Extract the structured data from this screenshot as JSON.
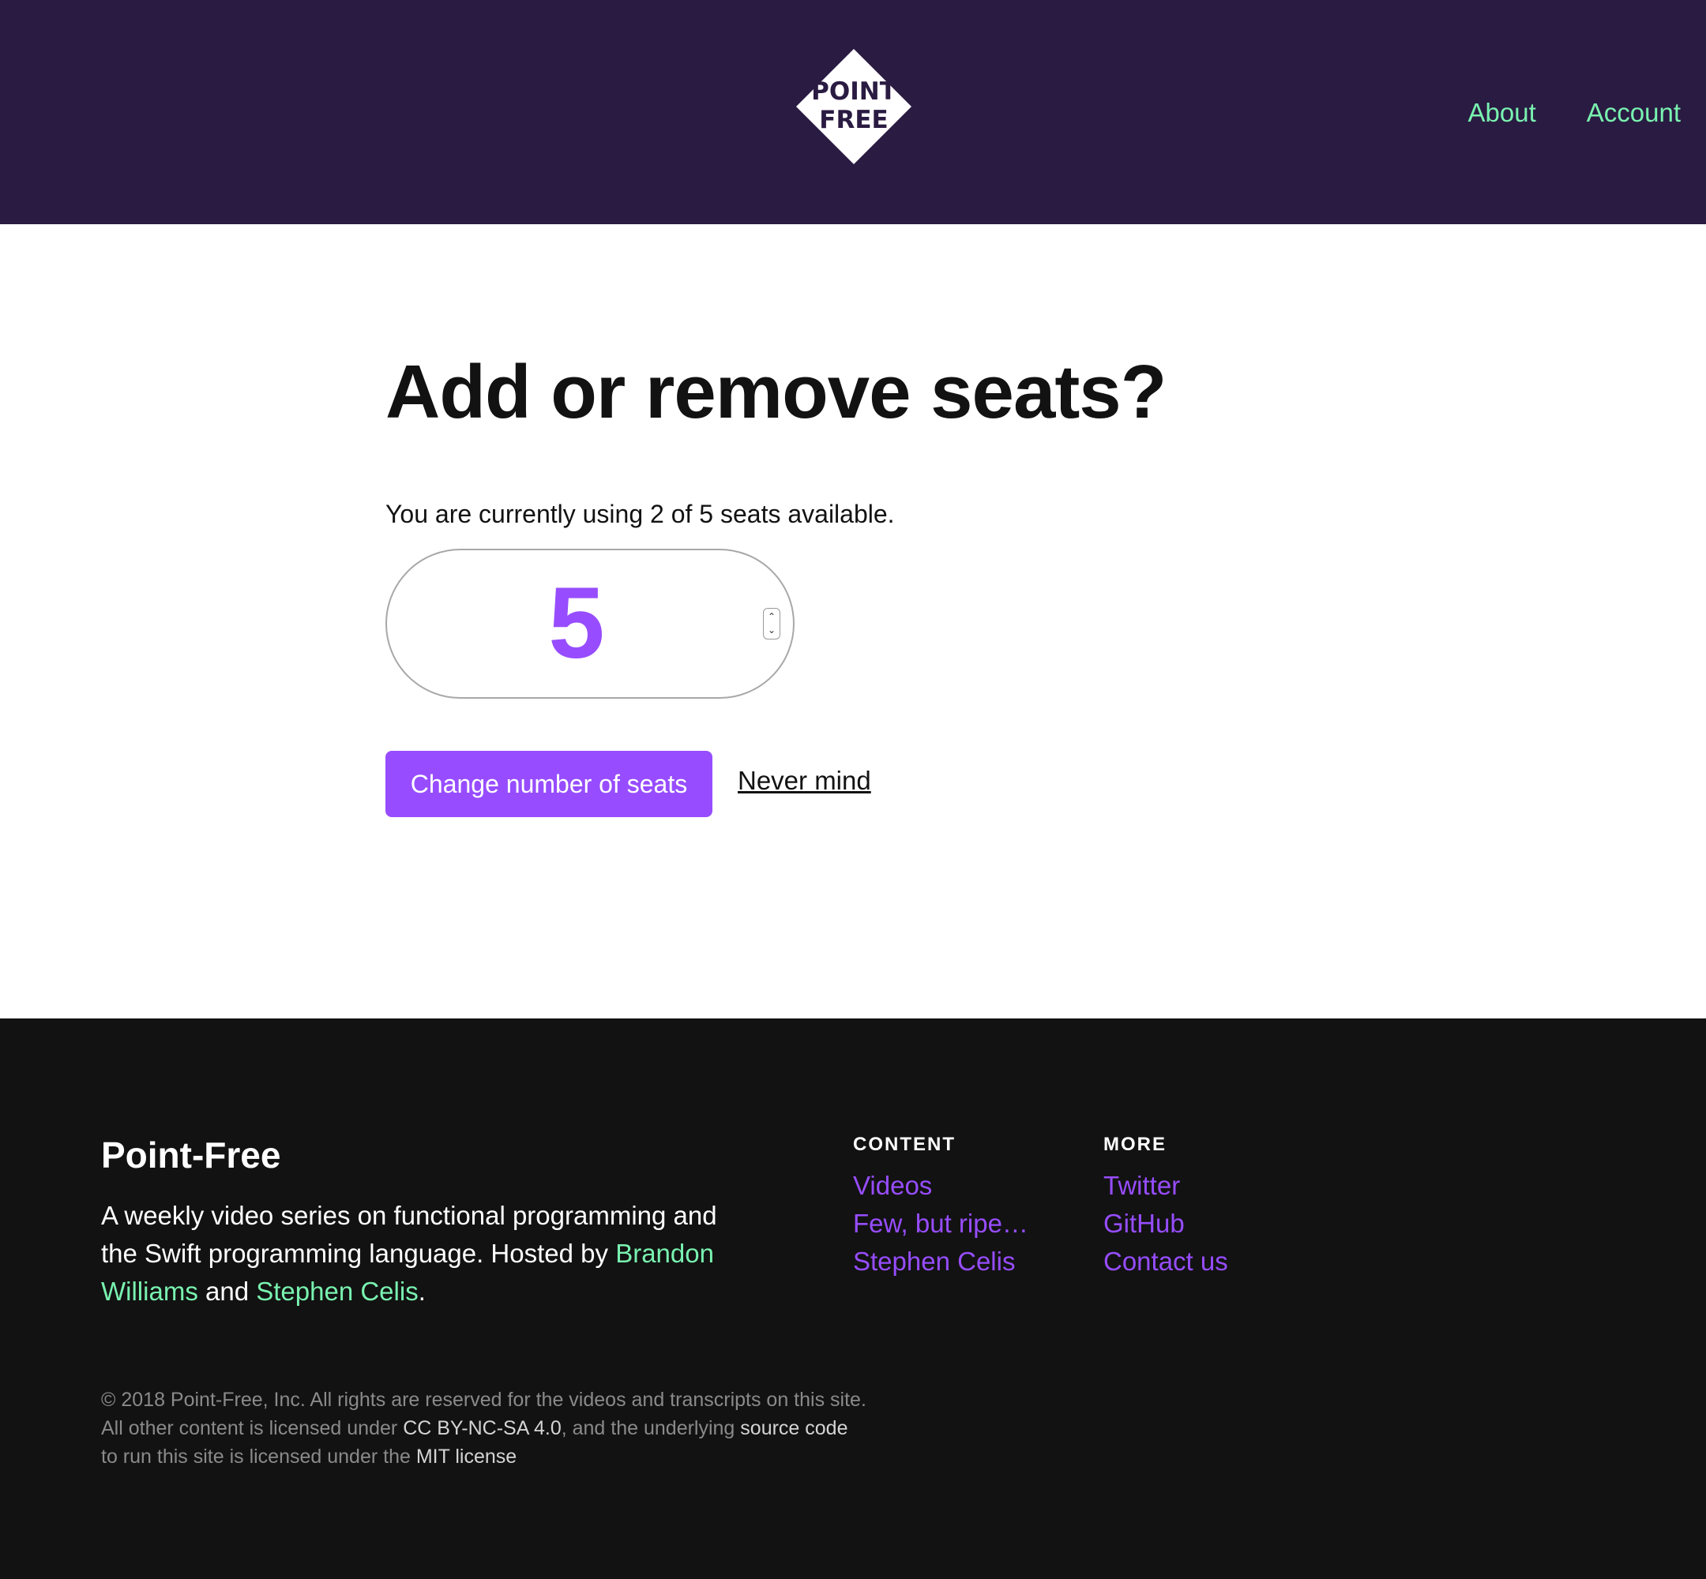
{
  "header": {
    "logo_line1": "POINT",
    "logo_line2": "FREE",
    "nav": {
      "about": "About",
      "account": "Account"
    }
  },
  "main": {
    "title": "Add or remove seats?",
    "status_text": "You are currently using 2 of 5 seats available.",
    "seats_value": "5",
    "submit_label": "Change number of seats",
    "cancel_label": "Never mind"
  },
  "footer": {
    "brand": "Point-Free",
    "description_text": "A weekly video series on functional programming and the Swift programming language. Hosted by",
    "host1": "Brandon Williams",
    "and_text": "and",
    "host2": "Stephen Celis",
    "period": ".",
    "content_heading": "CONTENT",
    "content_links": [
      "Videos",
      "Few, but ripe…",
      "Stephen Celis"
    ],
    "more_heading": "MORE",
    "more_links": [
      "Twitter",
      "GitHub",
      "Contact us"
    ],
    "legal_part1": "© 2018 Point-Free, Inc. All rights are reserved for the videos and transcripts on this site. All other content is licensed under",
    "legal_link1": "CC BY-NC-SA 4.0",
    "legal_part2": ", and the underlying",
    "legal_link2": "source code",
    "legal_part3": "to run this site is licensed under the",
    "legal_link3": "MIT license"
  },
  "colors": {
    "header_bg": "#2a1b42",
    "accent_green": "#79f2b0",
    "accent_purple": "#974dff",
    "footer_bg": "#121212"
  },
  "icons": [
    "point-free-logo",
    "spinner-up-icon",
    "spinner-down-icon"
  ]
}
